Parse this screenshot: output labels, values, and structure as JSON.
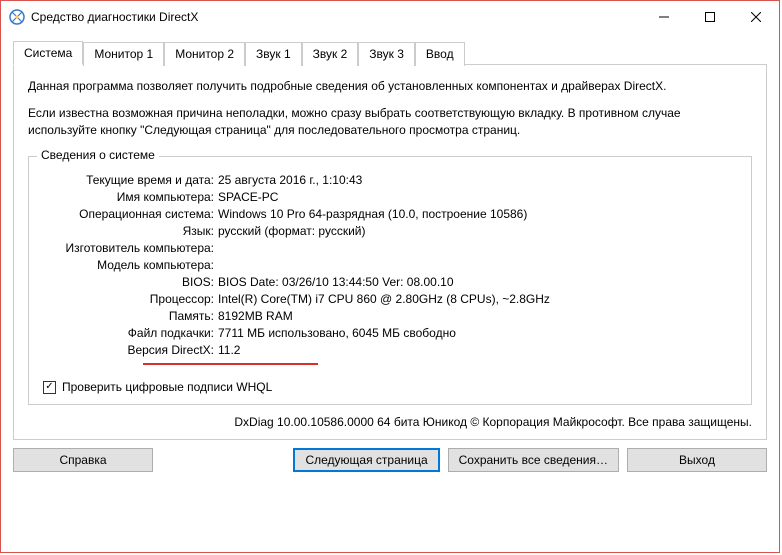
{
  "window": {
    "title": "Средство диагностики DirectX"
  },
  "tabs": [
    {
      "label": "Система"
    },
    {
      "label": "Монитор 1"
    },
    {
      "label": "Монитор 2"
    },
    {
      "label": "Звук 1"
    },
    {
      "label": "Звук 2"
    },
    {
      "label": "Звук 3"
    },
    {
      "label": "Ввод"
    }
  ],
  "intro1": "Данная программа позволяет получить подробные сведения об установленных компонентах и драйверах DirectX.",
  "intro2": "Если известна возможная причина неполадки, можно сразу выбрать соответствующую вкладку. В противном случае используйте кнопку \"Следующая страница\" для последовательного просмотра страниц.",
  "group": {
    "title": "Сведения о системе",
    "rows": [
      {
        "label": "Текущие время и дата:",
        "value": "25 августа 2016 г., 1:10:43"
      },
      {
        "label": "Имя компьютера:",
        "value": "SPACE-PC"
      },
      {
        "label": "Операционная система:",
        "value": "Windows 10 Pro 64-разрядная (10.0, построение 10586)"
      },
      {
        "label": "Язык:",
        "value": "русский (формат: русский)"
      },
      {
        "label": "Изготовитель компьютера:",
        "value": ""
      },
      {
        "label": "Модель компьютера:",
        "value": ""
      },
      {
        "label": "BIOS:",
        "value": "BIOS Date: 03/26/10 13:44:50 Ver: 08.00.10"
      },
      {
        "label": "Процессор:",
        "value": "Intel(R) Core(TM) i7 CPU         860  @ 2.80GHz (8 CPUs), ~2.8GHz"
      },
      {
        "label": "Память:",
        "value": "8192MB RAM"
      },
      {
        "label": "Файл подкачки:",
        "value": "7711 МБ использовано, 6045 МБ свободно"
      },
      {
        "label": "Версия DirectX:",
        "value": "11.2"
      }
    ],
    "checkbox_label": "Проверить цифровые подписи WHQL"
  },
  "copyright": "DxDiag 10.00.10586.0000 64 бита Юникод © Корпорация Майкрософт. Все права защищены.",
  "buttons": {
    "help": "Справка",
    "next": "Следующая страница",
    "save": "Сохранить все сведения…",
    "exit": "Выход"
  }
}
